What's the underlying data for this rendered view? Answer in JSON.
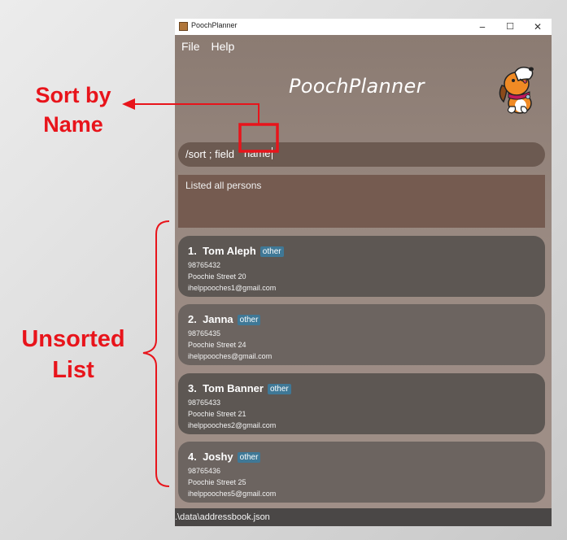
{
  "annotations": {
    "sort_label": "Sort by Name",
    "unsorted_label": "Unsorted List",
    "accent": "#e8141b"
  },
  "window": {
    "title": "PoochPlanner",
    "minimize": "‒",
    "maximize": "☐",
    "close": "✕"
  },
  "menu": {
    "file": "File",
    "help": "Help"
  },
  "app": {
    "title": "PoochPlanner",
    "logo": "dog-mascot-icon"
  },
  "command": {
    "prefix": "/sort ; field",
    "value": "name"
  },
  "result": {
    "text": "Listed all persons"
  },
  "persons": [
    {
      "index": "1.",
      "name": "Tom Aleph",
      "tag": "other",
      "phone": "98765432",
      "address": "Poochie Street 20",
      "email": "ihelppooches1@gmail.com"
    },
    {
      "index": "2.",
      "name": "Janna",
      "tag": "other",
      "phone": "98765435",
      "address": "Poochie Street 24",
      "email": "ihelppooches@gmail.com"
    },
    {
      "index": "3.",
      "name": "Tom Banner",
      "tag": "other",
      "phone": "98765433",
      "address": "Poochie Street 21",
      "email": "ihelppooches2@gmail.com"
    },
    {
      "index": "4.",
      "name": "Joshy",
      "tag": "other",
      "phone": "98765436",
      "address": "Poochie Street 25",
      "email": "ihelppooches5@gmail.com"
    }
  ],
  "status": {
    "path": ".\\data\\addressbook.json"
  }
}
